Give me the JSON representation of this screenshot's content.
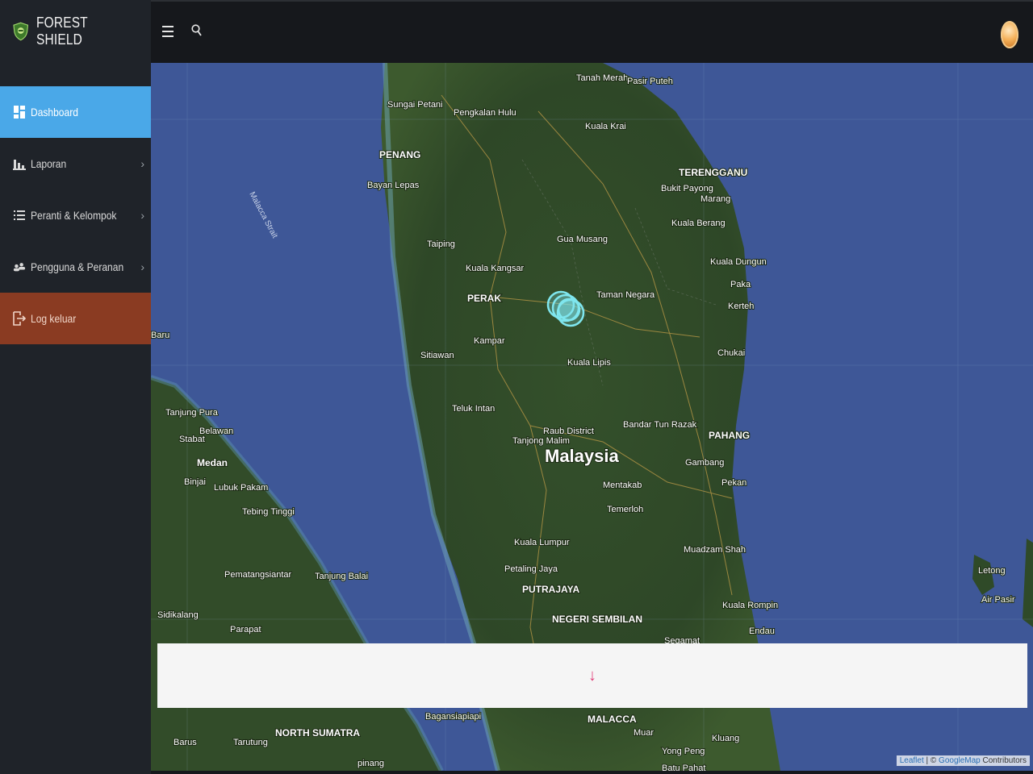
{
  "brand": {
    "title": "FOREST SHIELD",
    "logo_icon": "shield-icon"
  },
  "nav": {
    "items": [
      {
        "label": "Dashboard",
        "icon": "dashboard-icon",
        "active": true
      },
      {
        "label": "Laporan",
        "icon": "bar-chart-icon",
        "has_submenu": true
      },
      {
        "label": "Peranti & Kelompok",
        "icon": "list-icon",
        "has_submenu": true
      },
      {
        "label": "Pengguna & Peranan",
        "icon": "users-icon",
        "has_submenu": true
      },
      {
        "label": "Log keluar",
        "icon": "logout-icon"
      }
    ]
  },
  "topbar": {
    "menu_icon": "hamburger-icon",
    "search_icon": "search-icon",
    "avatar": "user-avatar"
  },
  "map": {
    "labels": {
      "country": "Malaysia",
      "perak": "PERAK",
      "penang": "PENANG",
      "terengganu": "TERENGGANU",
      "pahang": "PAHANG",
      "kuala_lumpur": "Kuala Lumpur",
      "petaling_jaya": "Petaling Jaya",
      "putrajaya": "PUTRAJAYA",
      "negeri_sembilan": "NEGERI SEMBILAN",
      "malacca": "MALACCA",
      "north_sumatra": "NORTH SUMATRA",
      "medan": "Medan",
      "taman_negara": "Taman Negara",
      "kuala_lipis": "Kuala Lipis",
      "taiping": "Taiping",
      "kuala_kangsar": "Kuala Kangsar",
      "gua_musang": "Gua Musang",
      "kuala_krai": "Kuala Krai",
      "sungai_petani": "Sungai Petani",
      "kuala_dungun": "Kuala Dungun",
      "malacca_strait": "Malacca Strait",
      "tanah_merah": "Tanah Merah",
      "pasir_puteh": "Pasir Puteh",
      "bayan_lepas": "Bayan Lepas",
      "kampar": "Kampar",
      "sitiawan": "Sitiawan",
      "teluk_intan": "Teluk Intan",
      "raub": "Raub District",
      "bentong": "Bandar Tun Razak",
      "temerloh": "Temerloh",
      "mentakab": "Mentakab",
      "gambang": "Gambang",
      "pekan": "Pekan",
      "kuala_rompin": "Kuala Rompin",
      "muadzam": "Muadzam Shah",
      "tebing_tinggi": "Tebing Tinggi",
      "pematangsiantar": "Pematangsiantar",
      "tanjung_balai": "Tanjung Balai",
      "binjai": "Binjai",
      "belawan": "Belawan",
      "kuantan_chukai": "Chukai",
      "kerteh": "Kerteh",
      "paka": "Paka",
      "kuala_berang": "Kuala Berang",
      "marang": "Marang",
      "bukit_payong": "Bukit Payong",
      "muar": "Muar",
      "kluang": "Kluang",
      "endau": "Endau",
      "segamat": "Segamat",
      "tioman_air_pasir": "Air Pasir",
      "tioman_letong": "Letong",
      "barus": "Barus",
      "tarutung": "Tarutung",
      "sidikalang": "Sidikalang",
      "parapat": "Parapat",
      "bagansiapiapi": "Bagansiapiapi",
      "tanjung_malim": "Tanjong Malim",
      "baru": "Baru",
      "tanjung_pura": "Tanjung Pura",
      "stabat": "Stabat",
      "lubuk_pakam": "Lubuk Pakam",
      "pengkalan_hulu": "Pengkalan Hulu",
      "pinang": "pinang",
      "yong_peng": "Yong Peng",
      "batu_pahat": "Batu Pahat"
    },
    "markers": [
      {
        "name": "sensor-cluster",
        "count": 4,
        "color": "#7fe6ee"
      }
    ],
    "attribution": {
      "leaflet": "Leaflet",
      "separator": " | © ",
      "provider": "GoogleMap",
      "suffix": " Contributors"
    }
  },
  "panel": {
    "arrow": "↓",
    "arrow_color": "#e0407a"
  },
  "colors": {
    "sidebar_bg": "#1f2329",
    "active_bg": "#4aa8e8",
    "logout_bg": "#8a3b22",
    "topbar_bg": "#16181c",
    "sea": "#3e5797",
    "land": "#2f4a2a"
  }
}
